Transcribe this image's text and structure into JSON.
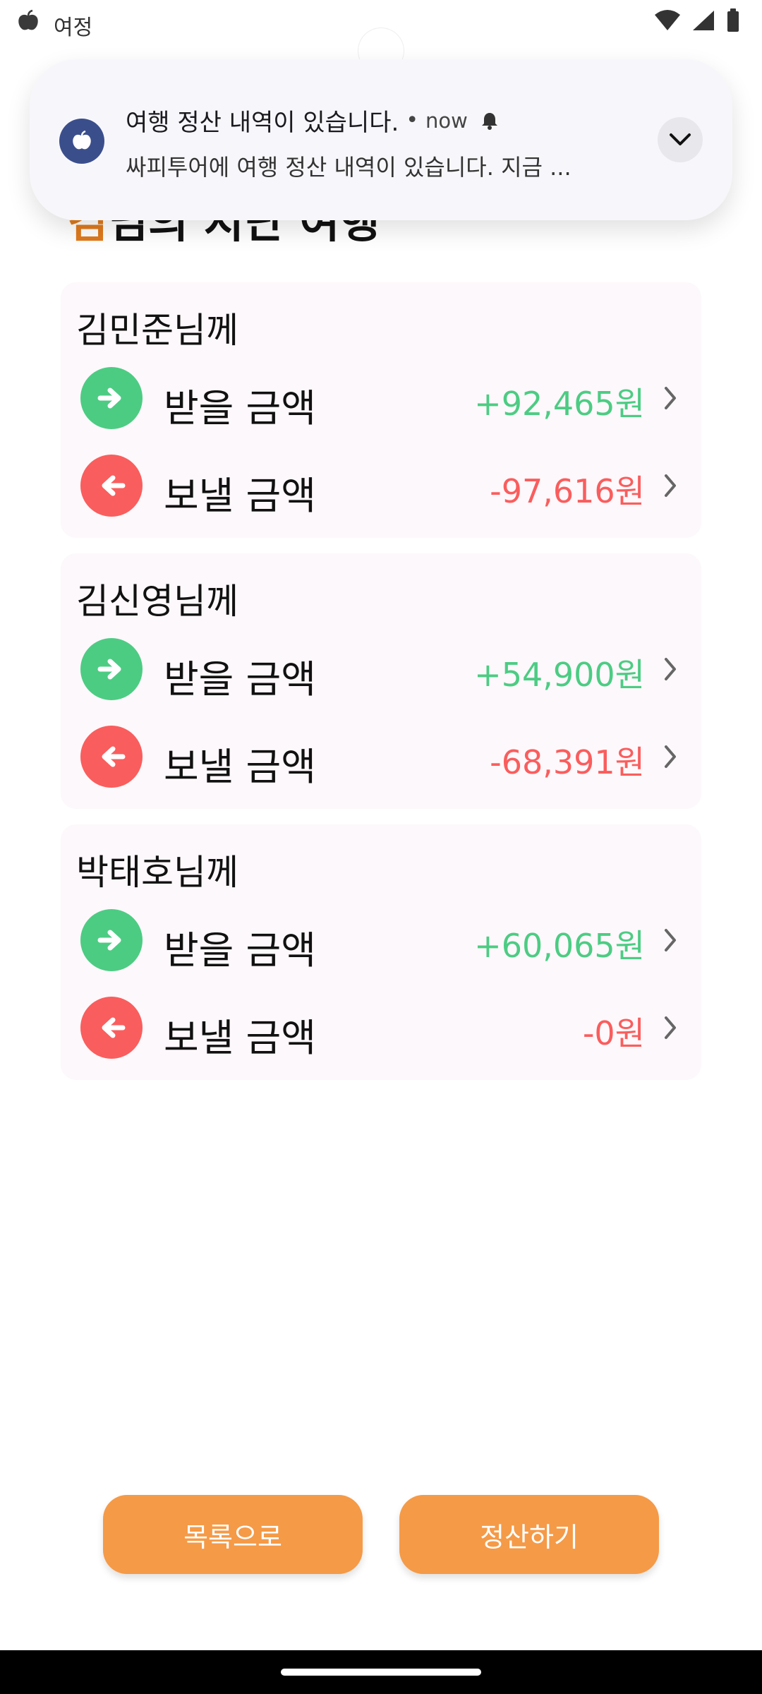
{
  "status_bar": {
    "app_label": "여정"
  },
  "page": {
    "heading_highlight": "김",
    "heading_rest": "님의 지난 여행"
  },
  "notification": {
    "title": "여행 정산 내역이 있습니다.",
    "separator": "•",
    "time": "now",
    "body": "싸피투어에 여행 정산 내역이 있습니다. 지금 ..."
  },
  "settlements": [
    {
      "name": "김민준님께",
      "receive": {
        "label": "받을 금액",
        "amount": "+92,465원"
      },
      "send": {
        "label": "보낼 금액",
        "amount": "-97,616원"
      }
    },
    {
      "name": "김신영님께",
      "receive": {
        "label": "받을 금액",
        "amount": "+54,900원"
      },
      "send": {
        "label": "보낼 금액",
        "amount": "-68,391원"
      }
    },
    {
      "name": "박태호님께",
      "receive": {
        "label": "받을 금액",
        "amount": "+60,065원"
      },
      "send": {
        "label": "보낼 금액",
        "amount": "-0원"
      }
    }
  ],
  "buttons": {
    "list": "목록으로",
    "settle": "정산하기"
  },
  "colors": {
    "receive": "#4ccc83",
    "send": "#fa5d5d",
    "button": "#f59a47",
    "heading_highlight": "#e07a1c",
    "notification_icon": "#3b4e8c"
  }
}
